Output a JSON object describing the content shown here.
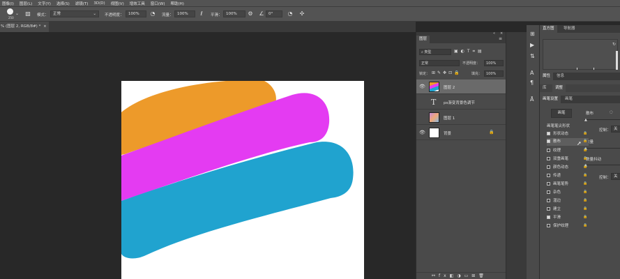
{
  "menubar": {
    "items": [
      "图像(I)",
      "图层(L)",
      "文字(Y)",
      "选择(S)",
      "滤镜(T)",
      "3D(D)",
      "视图(V)",
      "增效工具",
      "窗口(W)",
      "帮助(H)"
    ]
  },
  "options": {
    "brush_size": "250",
    "mode_label": "模式：",
    "mode_value": "正常",
    "opacity_label": "不透明度：",
    "opacity_value": "100%",
    "flow_label": "流量：",
    "flow_value": "100%",
    "smoothing_label": "平滑：",
    "smoothing_value": "100%",
    "angle_value": "0°"
  },
  "document": {
    "tab_label": "% (图层 2, RGB/8#) *"
  },
  "canvas": {
    "strokes": [
      {
        "name": "orange-stroke",
        "color": "#ED9A2A"
      },
      {
        "name": "magenta-stroke",
        "color": "#E43BF2"
      },
      {
        "name": "blue-stroke",
        "color": "#20A3CF"
      }
    ]
  },
  "layers_panel": {
    "title": "图层",
    "kind_filter": "类型",
    "blend_mode": "正常",
    "opacity_label": "不透明度：",
    "opacity_value": "100%",
    "lock_label": "锁定：",
    "fill_label": "填充：",
    "fill_value": "100%",
    "layers": [
      {
        "name": "图层 2",
        "type": "pixel",
        "visible": true,
        "selected": true
      },
      {
        "name": "ps渐变背景色调节",
        "type": "text",
        "visible": false,
        "selected": false
      },
      {
        "name": "图层 1",
        "type": "pixel",
        "visible": false,
        "selected": false
      },
      {
        "name": "背景",
        "type": "background",
        "visible": true,
        "selected": false,
        "locked": true
      }
    ]
  },
  "histogram_panel": {
    "tabs": [
      "直方图",
      "导航器"
    ]
  },
  "properties_panel": {
    "tabs": [
      "属性",
      "信息"
    ],
    "subtabs": [
      "库",
      "调整"
    ]
  },
  "brush_panel": {
    "tabs": [
      "画笔设置",
      "画笔"
    ],
    "brush_button": "画笔",
    "scatter_label": "散布",
    "brush_tip_label": "画笔笔尖形状",
    "control_label": "控制：",
    "control_value": "关",
    "count_label": "数量",
    "count_jitter_label": "数量抖动",
    "items": [
      {
        "label": "形状动态",
        "checked": true
      },
      {
        "label": "散布",
        "checked": true
      },
      {
        "label": "纹理",
        "checked": false
      },
      {
        "label": "双重画笔",
        "checked": false
      },
      {
        "label": "颜色动态",
        "checked": false
      },
      {
        "label": "传递",
        "checked": false
      },
      {
        "label": "画笔笔势",
        "checked": false
      },
      {
        "label": "杂色",
        "checked": false
      },
      {
        "label": "湿边",
        "checked": false
      },
      {
        "label": "建立",
        "checked": false
      },
      {
        "label": "平滑",
        "checked": true
      },
      {
        "label": "保护纹理",
        "checked": false
      }
    ]
  },
  "colors": {
    "panel_bg": "#4a4a4a",
    "bar_bg": "#535353",
    "workspace_bg": "#282828",
    "selected_row": "#6a6a6a"
  }
}
